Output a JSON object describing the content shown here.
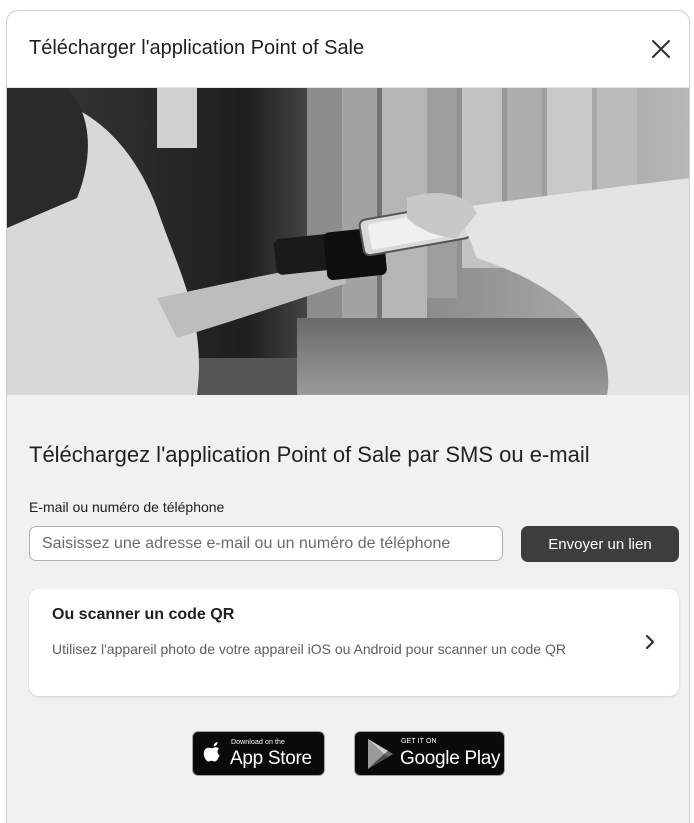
{
  "header": {
    "title": "Télécharger l'application Point of Sale",
    "close_icon": "close-icon"
  },
  "hero": {
    "image": "photo-card-payment-in-clothing-store"
  },
  "main": {
    "section_title": "Téléchargez l'application Point of Sale par SMS ou e-mail",
    "field_label": "E-mail ou numéro de téléphone",
    "input_placeholder": "Saisissez une adresse e-mail ou un numéro de téléphone",
    "input_value": "",
    "send_button_label": "Envoyer un lien"
  },
  "qr_card": {
    "title": "Ou scanner un code QR",
    "description": "Utilisez l'appareil photo de votre appareil iOS ou Android pour scanner un code QR",
    "chevron_icon": "chevron-right-icon"
  },
  "stores": {
    "apple": {
      "small_text": "Download on the",
      "big_text": "App Store",
      "icon": "apple-icon"
    },
    "google": {
      "small_text": "GET IT ON",
      "big_text": "Google Play",
      "icon": "google-play-icon"
    }
  },
  "colors": {
    "modal_bg": "#f1f1f1",
    "button_bg": "#3d3d3d",
    "badge_bg": "#0a0a0a"
  }
}
